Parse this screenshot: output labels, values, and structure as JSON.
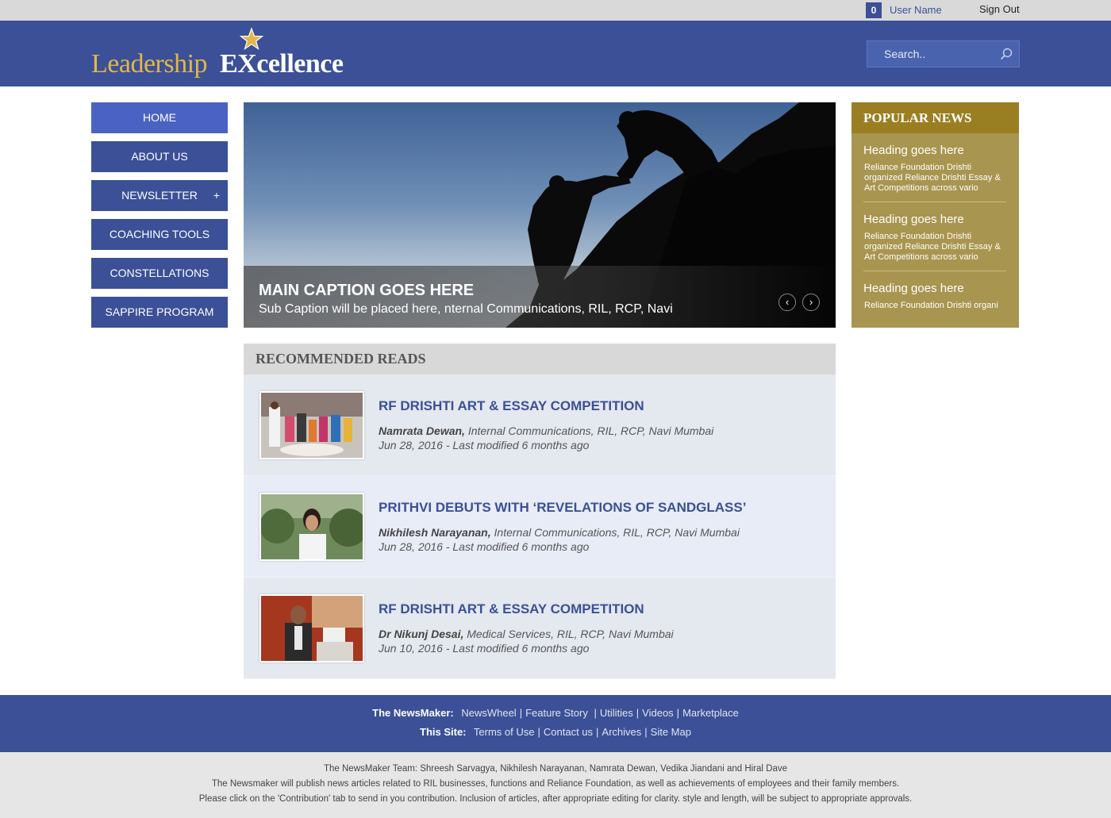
{
  "topbar": {
    "notification_count": "0",
    "user_name": "User Name",
    "sign_out": "Sign Out"
  },
  "header": {
    "logo_part1": "Leadership",
    "logo_part2": "EXcellence",
    "search_placeholder": "Search.."
  },
  "nav": {
    "items": [
      {
        "label": "HOME"
      },
      {
        "label": "ABOUT US"
      },
      {
        "label": "NEWSLETTER",
        "expand": "+"
      },
      {
        "label": "COACHING TOOLS"
      },
      {
        "label": "CONSTELLATIONS"
      },
      {
        "label": "SAPPIRE PROGRAM"
      }
    ]
  },
  "hero": {
    "title": "MAIN CAPTION GOES HERE",
    "subtitle": "Sub Caption will be placed here, nternal Communications, RIL, RCP, Navi",
    "prev_icon": "‹",
    "next_icon": "›"
  },
  "popular": {
    "heading": "POPULAR NEWS",
    "items": [
      {
        "title": "Heading goes here",
        "text": "Reliance Foundation Drishti organized Reliance Drishti Essay & Art Competitions across vario"
      },
      {
        "title": "Heading goes here",
        "text": "Reliance Foundation Drishti organized Reliance Drishti Essay & Art Competitions across vario"
      },
      {
        "title": "Heading goes here",
        "text": "Reliance Foundation Drishti organi"
      }
    ]
  },
  "recommended": {
    "heading": "RECOMMENDED READS",
    "items": [
      {
        "title": "RF DRISHTI ART & ESSAY COMPETITION",
        "author": "Namrata Dewan,",
        "dept": "Internal Communications, RIL, RCP, Navi Mumbai",
        "date": "Jun 28, 2016 - Last modified 6 months ago"
      },
      {
        "title": "PRITHVI DEBUTS WITH ‘REVELATIONS OF SANDGLASS’",
        "author": "Nikhilesh Narayanan,",
        "dept": "Internal Communications, RIL, RCP, Navi Mumbai",
        "date": "Jun 28, 2016 - Last modified 6 months ago"
      },
      {
        "title": "RF DRISHTI ART & ESSAY COMPETITION",
        "author": "Dr Nikunj Desai,",
        "dept": "Medical Services, RIL, RCP, Navi Mumbai",
        "date": "Jun 10, 2016 - Last modified 6 months ago"
      }
    ]
  },
  "footer": {
    "newsmaker_label": "The NewsMaker:",
    "newsmaker_links": [
      "NewsWheel",
      "Feature Story",
      "Utilities",
      "Videos",
      "Marketplace"
    ],
    "site_label": "This Site:",
    "site_links": [
      "Terms of Use",
      "Contact us",
      "Archives",
      "Site Map"
    ],
    "team": "The NewsMaker Team: Shreesh Sarvagya, Nikhilesh Narayanan, Namrata Dewan, Vedika Jiandani and Hiral Dave",
    "about": "The Newsmaker will publish news articles related to RIL businesses, functions and Reliance Foundation, as well as achievements of employees and their family members.",
    "contribute": "Please click on the 'Contribution' tab to send in you contribution. Inclusion of articles, after appropriate editing for clarity. style and length, will be subject to appropriate approvals."
  },
  "colors": {
    "brand_blue": "#3b5096",
    "gold": "#a8954f",
    "gold_dark": "#9a7f22"
  }
}
